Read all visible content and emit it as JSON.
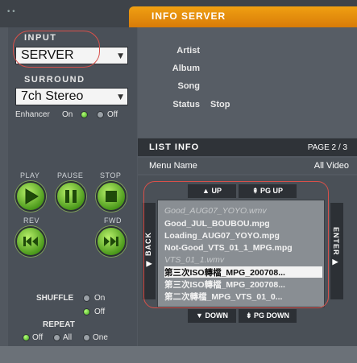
{
  "window": {
    "title": "INFO SERVER",
    "controls": "••"
  },
  "input": {
    "label": "INPUT",
    "value": "SERVER"
  },
  "surround": {
    "label": "SURROUND",
    "value": "7ch Stereo"
  },
  "enhancer": {
    "label": "Enhancer",
    "on": "On",
    "off": "Off",
    "selected": "On"
  },
  "transport": {
    "play": "PLAY",
    "pause": "PAUSE",
    "stop": "STOP",
    "rev": "REV",
    "fwd": "FWD"
  },
  "shuffle": {
    "label": "SHUFFLE",
    "on": "On",
    "off": "Off",
    "selected": "Off"
  },
  "repeat": {
    "label": "REPEAT",
    "off": "Off",
    "all": "All",
    "one": "One",
    "selected": "Off"
  },
  "info": {
    "artist_label": "Artist",
    "artist_value": "",
    "album_label": "Album",
    "album_value": "",
    "song_label": "Song",
    "song_value": "",
    "status_label": "Status",
    "status_value": "Stop"
  },
  "list": {
    "title": "LIST INFO",
    "page": "PAGE 2 / 3",
    "menu_name_label": "Menu Name",
    "menu_name_value": "All Video",
    "up": "▲ UP",
    "pg_up": "⇞ PG UP",
    "down": "▼ DOWN",
    "pg_down": "⇟ PG DOWN",
    "back": "◀ BACK",
    "enter": "ENTER ▶",
    "items": [
      "Good_AUG07_YOYO.wmv",
      "Good_JUL_BOUBOU.mpg",
      "Loading_AUG07_YOYO.mpg",
      "Not-Good_VTS_01_1_MPG.mpg",
      "VTS_01_1.wmv",
      "第三次ISO轉檔_MPG_200708...",
      "第三次ISO轉檔_MPG_200708...",
      "第二次轉檔_MPG_VTS_01_0..."
    ],
    "selected_index": 5
  }
}
